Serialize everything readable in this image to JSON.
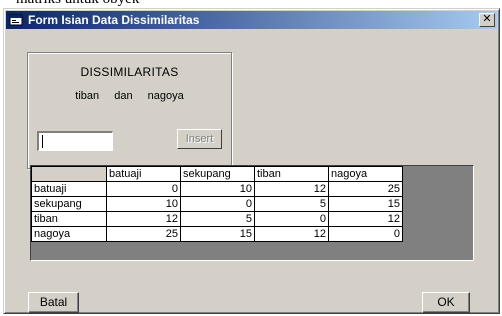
{
  "cut_caption": "matriks untuk obyek",
  "window": {
    "title": "Form Isian Data Dissimilaritas",
    "close_label": "✕"
  },
  "group": {
    "title": "DISSIMILARITAS",
    "name_a": "tiban",
    "connector": "dan",
    "name_b": "nagoya"
  },
  "input": {
    "value": ""
  },
  "insert_button": "Insert",
  "grid": {
    "columns": [
      "batuaji",
      "sekupang",
      "tiban",
      "nagoya"
    ],
    "rows": [
      {
        "label": "batuaji",
        "values": [
          "0",
          "10",
          "12",
          "25"
        ]
      },
      {
        "label": "sekupang",
        "values": [
          "10",
          "0",
          "5",
          "15"
        ]
      },
      {
        "label": "tiban",
        "values": [
          "12",
          "5",
          "0",
          "12"
        ]
      },
      {
        "label": "nagoya",
        "values": [
          "25",
          "15",
          "12",
          "0"
        ]
      }
    ]
  },
  "buttons": {
    "batal": "Batal",
    "ok": "OK"
  }
}
